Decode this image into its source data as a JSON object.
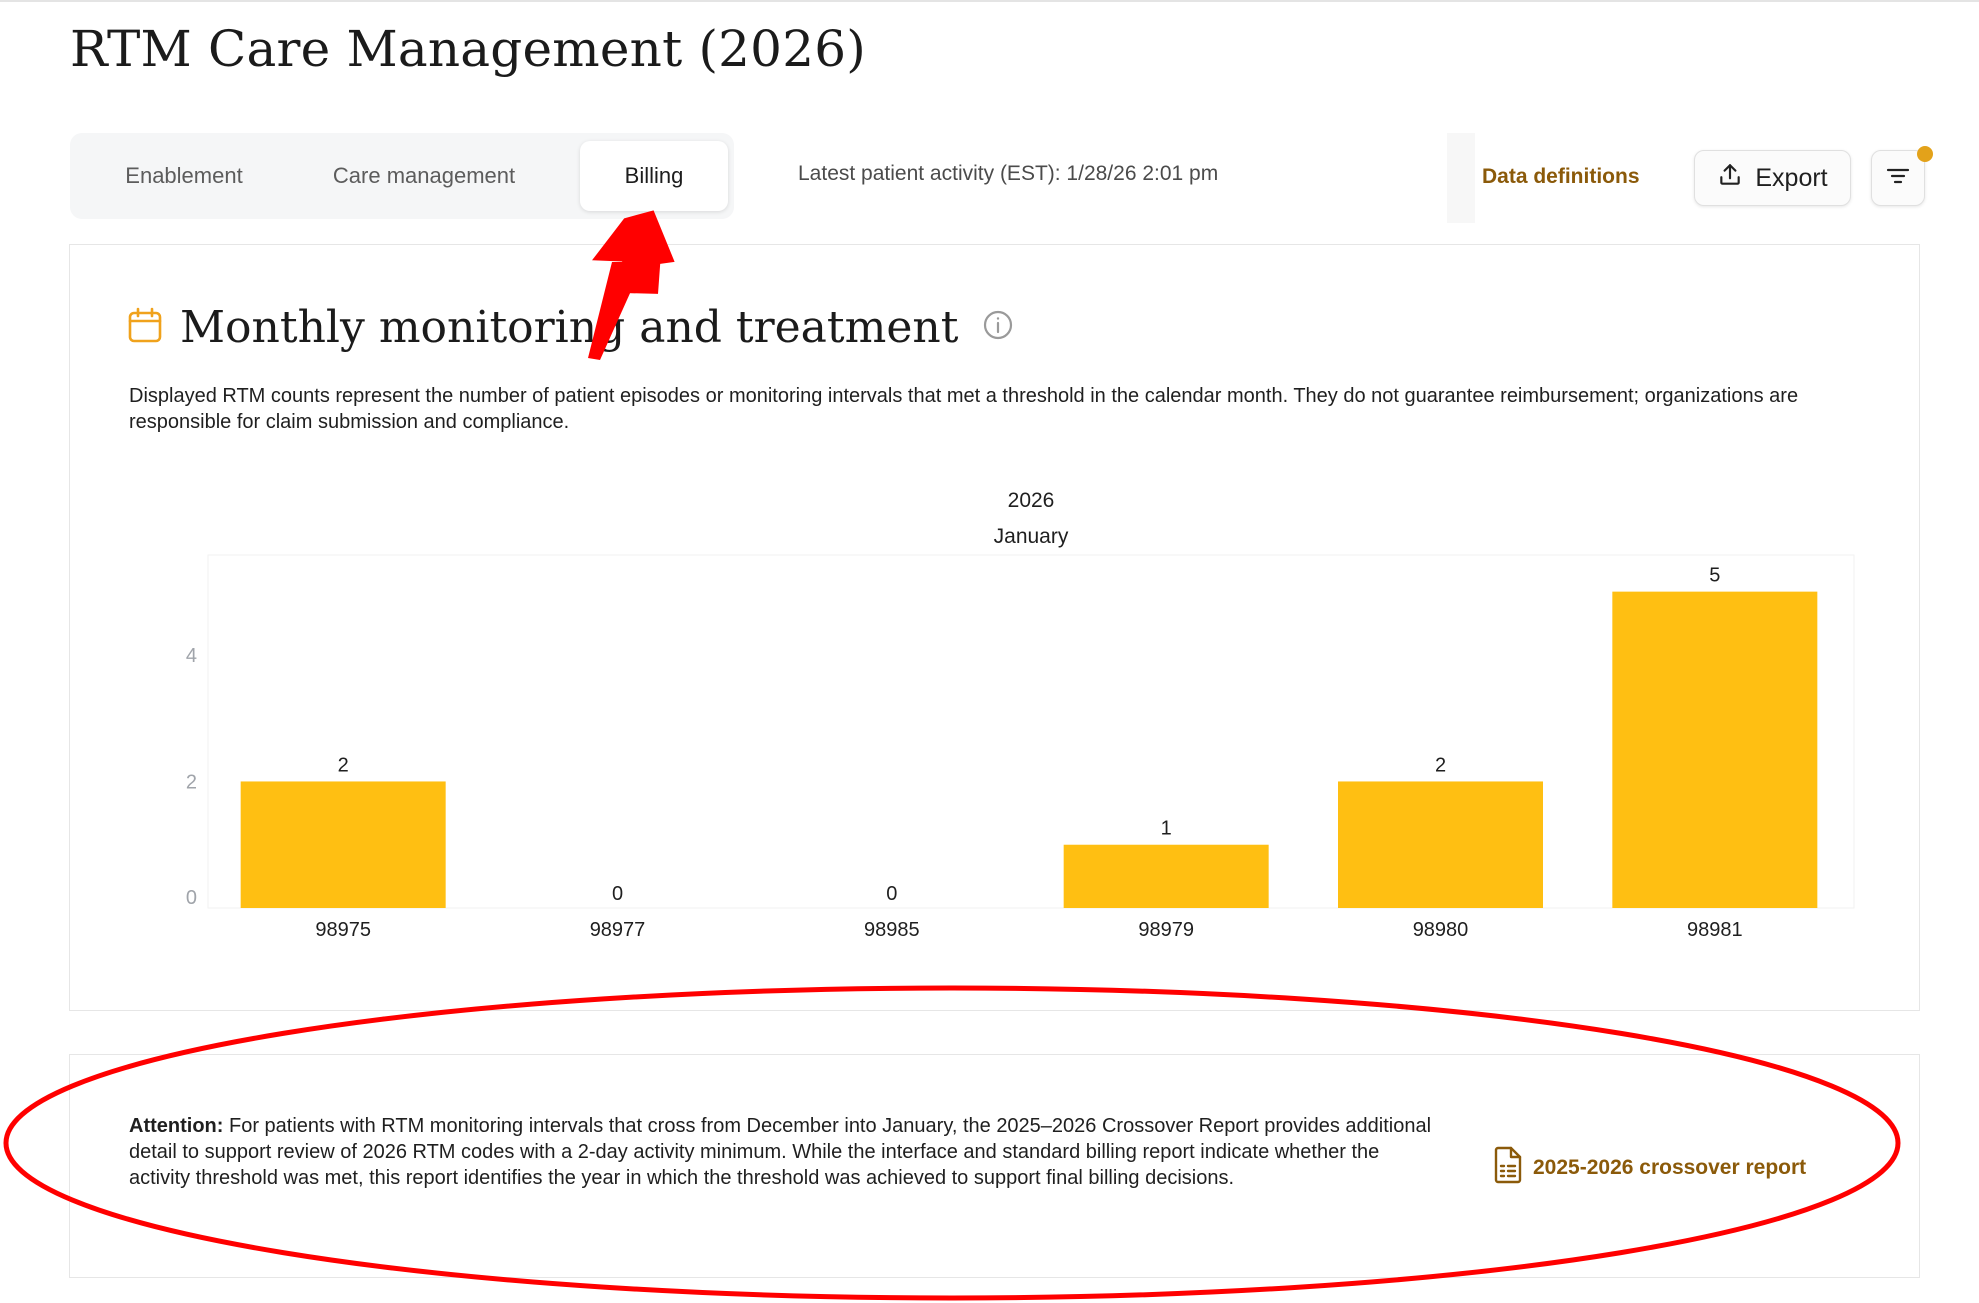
{
  "page": {
    "title": "RTM Care Management (2026)"
  },
  "tabs": [
    {
      "label": "Enablement",
      "active": false
    },
    {
      "label": "Care management",
      "active": false
    },
    {
      "label": "Billing",
      "active": true
    }
  ],
  "header": {
    "latest_activity": "Latest patient activity (EST): 1/28/26 2:01 pm",
    "data_definitions": "Data definitions",
    "export_label": "Export"
  },
  "section": {
    "title": "Monthly monitoring and treatment",
    "description": "Displayed RTM counts represent the number of patient episodes or monitoring intervals that met a threshold in the calendar month. They do not guarantee reimbursement; organizations are responsible for claim submission and compliance."
  },
  "chart_data": {
    "type": "bar",
    "title": "2026",
    "subtitle": "January",
    "categories": [
      "98975",
      "98977",
      "98985",
      "98979",
      "98980",
      "98981"
    ],
    "values": [
      2,
      0,
      0,
      1,
      2,
      5
    ],
    "yticks": [
      0,
      2,
      4
    ],
    "ylim": [
      0,
      5.5
    ],
    "data_labels": true,
    "bar_color": "#ffbf12"
  },
  "attention": {
    "label": "Attention:",
    "text": " For patients with RTM monitoring intervals that cross from December into January, the 2025–2026 Crossover Report provides additional detail to support review of 2026 RTM codes with a 2-day activity minimum. While the interface and standard billing report indicate whether the activity threshold was met, this report identifies the year in which the threshold was achieved to support final billing decisions.",
    "link_label": "2025-2026 crossover report"
  },
  "colors": {
    "accent": "#8b5a0a",
    "bar": "#ffbf12",
    "icon_orange": "#f0a21c",
    "annotation_red": "#ff0000"
  },
  "icons": {
    "calendar": "calendar-icon",
    "info": "info-icon",
    "export": "upload-icon",
    "filter": "filter-icon",
    "document": "document-icon"
  }
}
